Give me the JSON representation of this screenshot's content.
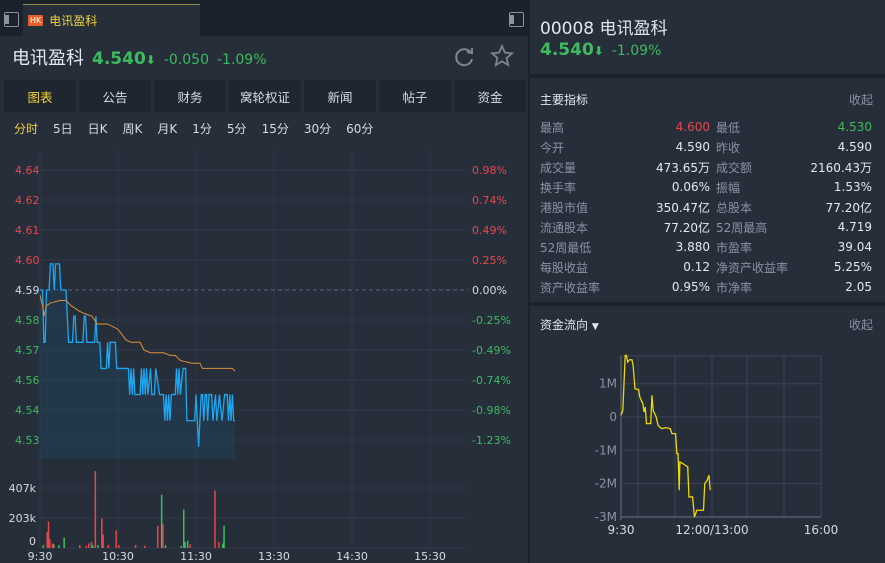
{
  "tab": {
    "market": "HK",
    "name": "电讯盈科"
  },
  "quote": {
    "name": "电讯盈科",
    "price": "4.540",
    "arrow": "⬇",
    "change": "-0.050",
    "change_pct": "-1.09%"
  },
  "menu": [
    {
      "label": "图表",
      "active": true
    },
    {
      "label": "公告"
    },
    {
      "label": "财务"
    },
    {
      "label": "窝轮权证"
    },
    {
      "label": "新闻"
    },
    {
      "label": "帖子"
    },
    {
      "label": "资金"
    }
  ],
  "periods": [
    {
      "label": "分时",
      "active": true
    },
    {
      "label": "5日"
    },
    {
      "label": "日K"
    },
    {
      "label": "周K"
    },
    {
      "label": "月K"
    },
    {
      "label": "1分"
    },
    {
      "label": "5分"
    },
    {
      "label": "15分"
    },
    {
      "label": "30分"
    },
    {
      "label": "60分"
    }
  ],
  "right": {
    "code_name": "00008 电讯盈科",
    "price": "4.540",
    "arrow": "⬇",
    "change_pct": "-1.09%"
  },
  "key_metrics": {
    "title": "主要指标",
    "collapse": "收起",
    "rows": [
      [
        {
          "label": "最高",
          "value": "4.600",
          "color": "#e8464d"
        },
        {
          "label": "最低",
          "value": "4.530",
          "color": "#3dbb5e"
        }
      ],
      [
        {
          "label": "今开",
          "value": "4.590"
        },
        {
          "label": "昨收",
          "value": "4.590"
        }
      ],
      [
        {
          "label": "成交量",
          "value": "473.65万"
        },
        {
          "label": "成交额",
          "value": "2160.43万"
        }
      ],
      [
        {
          "label": "换手率",
          "value": "0.06%"
        },
        {
          "label": "振幅",
          "value": "1.53%"
        }
      ],
      [
        {
          "label": "港股市值",
          "value": "350.47亿"
        },
        {
          "label": "总股本",
          "value": "77.20亿"
        }
      ],
      [
        {
          "label": "流通股本",
          "value": "77.20亿"
        },
        {
          "label": "52周最高",
          "value": "4.719"
        }
      ],
      [
        {
          "label": "52周最低",
          "value": "3.880"
        },
        {
          "label": "市盈率",
          "value": "39.04"
        }
      ],
      [
        {
          "label": "每股收益",
          "value": "0.12"
        },
        {
          "label": "净资产收益率",
          "value": "5.25%"
        }
      ],
      [
        {
          "label": "资产收益率",
          "value": "0.95%"
        },
        {
          "label": "市净率",
          "value": "2.05"
        }
      ]
    ]
  },
  "fund_flow": {
    "title": "资金流向",
    "collapse": "收起"
  },
  "colors": {
    "up": "#e8464d",
    "down": "#3dbb5e",
    "price_line": "#1ea7f0",
    "avg_line": "#e0903a",
    "flow_line": "#f0d800",
    "active": "#f0d23a"
  },
  "chart_data": [
    {
      "type": "line",
      "title": "分时",
      "prev_close": 4.59,
      "price_labels_left": [
        {
          "v": "4.64",
          "c": "up"
        },
        {
          "v": "4.62",
          "c": "up"
        },
        {
          "v": "4.61",
          "c": "up"
        },
        {
          "v": "4.60",
          "c": "up"
        },
        {
          "v": "4.59",
          "c": "flat"
        },
        {
          "v": "4.58",
          "c": "down"
        },
        {
          "v": "4.57",
          "c": "down"
        },
        {
          "v": "4.56",
          "c": "down"
        },
        {
          "v": "4.54",
          "c": "down"
        },
        {
          "v": "4.53",
          "c": "down"
        }
      ],
      "pct_labels_right": [
        {
          "v": "0.98%",
          "c": "up"
        },
        {
          "v": "0.74%",
          "c": "up"
        },
        {
          "v": "0.49%",
          "c": "up"
        },
        {
          "v": "0.25%",
          "c": "up"
        },
        {
          "v": "0.00%",
          "c": "flat"
        },
        {
          "v": "-0.25%",
          "c": "down"
        },
        {
          "v": "-0.49%",
          "c": "down"
        },
        {
          "v": "-0.74%",
          "c": "down"
        },
        {
          "v": "-0.98%",
          "c": "down"
        },
        {
          "v": "-1.23%",
          "c": "down"
        }
      ],
      "x_ticks": [
        "9:30",
        "10:30",
        "11:30",
        "13:30",
        "14:30",
        "15:30"
      ],
      "volume_ticks": [
        "407k",
        "203k",
        "0"
      ],
      "price": [
        [
          0,
          4.59
        ],
        [
          2,
          4.59
        ],
        [
          3,
          4.57
        ],
        [
          4,
          4.57
        ],
        [
          5,
          4.59
        ],
        [
          7,
          4.59
        ],
        [
          8,
          4.6
        ],
        [
          10,
          4.6
        ],
        [
          11,
          4.59
        ],
        [
          12,
          4.6
        ],
        [
          15,
          4.6
        ],
        [
          16,
          4.59
        ],
        [
          20,
          4.59
        ],
        [
          22,
          4.57
        ],
        [
          25,
          4.57
        ],
        [
          26,
          4.58
        ],
        [
          27,
          4.58
        ],
        [
          28,
          4.57
        ],
        [
          33,
          4.57
        ],
        [
          34,
          4.58
        ],
        [
          35,
          4.58
        ],
        [
          36,
          4.57
        ],
        [
          42,
          4.57
        ],
        [
          43,
          4.58
        ],
        [
          44,
          4.57
        ],
        [
          46,
          4.57
        ],
        [
          47,
          4.56
        ],
        [
          51,
          4.56
        ],
        [
          52,
          4.57
        ],
        [
          53,
          4.56
        ],
        [
          54,
          4.57
        ],
        [
          58,
          4.57
        ],
        [
          59,
          4.56
        ],
        [
          68,
          4.56
        ],
        [
          69,
          4.55
        ],
        [
          70,
          4.56
        ],
        [
          71,
          4.55
        ],
        [
          72,
          4.56
        ],
        [
          73,
          4.55
        ],
        [
          77,
          4.55
        ],
        [
          78,
          4.56
        ],
        [
          79,
          4.55
        ],
        [
          80,
          4.56
        ],
        [
          81,
          4.55
        ],
        [
          82,
          4.56
        ],
        [
          83,
          4.55
        ],
        [
          85,
          4.56
        ],
        [
          86,
          4.55
        ],
        [
          88,
          4.55
        ],
        [
          89,
          4.56
        ],
        [
          92,
          4.55
        ],
        [
          95,
          4.55
        ],
        [
          96,
          4.54
        ],
        [
          97,
          4.55
        ],
        [
          98,
          4.54
        ],
        [
          99,
          4.55
        ],
        [
          100,
          4.54
        ],
        [
          101,
          4.55
        ],
        [
          104,
          4.55
        ],
        [
          105,
          4.56
        ],
        [
          106,
          4.55
        ],
        [
          107,
          4.56
        ],
        [
          108,
          4.55
        ],
        [
          110,
          4.56
        ],
        [
          112,
          4.56
        ],
        [
          113,
          4.54
        ],
        [
          119,
          4.54
        ],
        [
          120,
          4.55
        ],
        [
          121,
          4.54
        ],
        [
          122,
          4.53
        ],
        [
          123,
          4.54
        ],
        [
          124,
          4.55
        ],
        [
          125,
          4.55
        ],
        [
          126,
          4.54
        ],
        [
          127,
          4.55
        ],
        [
          128,
          4.55
        ],
        [
          129,
          4.54
        ],
        [
          130,
          4.55
        ],
        [
          132,
          4.55
        ],
        [
          133,
          4.54
        ],
        [
          135,
          4.55
        ],
        [
          136,
          4.54
        ],
        [
          138,
          4.55
        ],
        [
          140,
          4.54
        ],
        [
          142,
          4.55
        ],
        [
          144,
          4.55
        ],
        [
          145,
          4.54
        ],
        [
          146,
          4.55
        ],
        [
          147,
          4.54
        ],
        [
          148,
          4.55
        ],
        [
          149,
          4.54
        ],
        [
          150,
          4.54
        ]
      ],
      "avg": [
        [
          0,
          4.588
        ],
        [
          2,
          4.584
        ],
        [
          3,
          4.58
        ],
        [
          5,
          4.584
        ],
        [
          8,
          4.585
        ],
        [
          15,
          4.586
        ],
        [
          20,
          4.586
        ],
        [
          24,
          4.584
        ],
        [
          30,
          4.582
        ],
        [
          34,
          4.581
        ],
        [
          40,
          4.58
        ],
        [
          44,
          4.577
        ],
        [
          52,
          4.577
        ],
        [
          60,
          4.575
        ],
        [
          63,
          4.573
        ],
        [
          66,
          4.571
        ],
        [
          70,
          4.57
        ],
        [
          77,
          4.57
        ],
        [
          80,
          4.567
        ],
        [
          85,
          4.566
        ],
        [
          95,
          4.566
        ],
        [
          100,
          4.565
        ],
        [
          104,
          4.565
        ],
        [
          108,
          4.563
        ],
        [
          117,
          4.562
        ],
        [
          123,
          4.562
        ],
        [
          125,
          4.56
        ],
        [
          148,
          4.56
        ],
        [
          150,
          4.559
        ]
      ],
      "volume_k": [
        [
          2,
          20,
          "d"
        ],
        [
          5,
          110,
          "u"
        ],
        [
          6,
          180,
          "u"
        ],
        [
          7,
          60,
          "u"
        ],
        [
          9,
          30,
          "u"
        ],
        [
          10,
          25,
          "d"
        ],
        [
          14,
          20,
          "d"
        ],
        [
          18,
          70,
          "d"
        ],
        [
          30,
          20,
          "u"
        ],
        [
          35,
          15,
          "u"
        ],
        [
          37,
          30,
          "u"
        ],
        [
          39,
          40,
          "u"
        ],
        [
          40,
          20,
          "d"
        ],
        [
          42,
          520,
          "u"
        ],
        [
          44,
          20,
          "d"
        ],
        [
          47,
          200,
          "u"
        ],
        [
          48,
          90,
          "u"
        ],
        [
          52,
          20,
          "u"
        ],
        [
          58,
          120,
          "u"
        ],
        [
          60,
          20,
          "u"
        ],
        [
          73,
          20,
          "u"
        ],
        [
          80,
          15,
          "u"
        ],
        [
          90,
          150,
          "u"
        ],
        [
          93,
          360,
          "d"
        ],
        [
          94,
          160,
          "u"
        ],
        [
          96,
          20,
          "d"
        ],
        [
          108,
          15,
          "d"
        ],
        [
          110,
          260,
          "d"
        ],
        [
          111,
          40,
          "d"
        ],
        [
          113,
          50,
          "d"
        ],
        [
          115,
          25,
          "u"
        ],
        [
          134,
          390,
          "u"
        ],
        [
          137,
          40,
          "u"
        ],
        [
          140,
          30,
          "d"
        ],
        [
          141,
          150,
          "d"
        ]
      ]
    },
    {
      "type": "line",
      "title": "资金流向",
      "y_ticks": [
        "1M",
        "0",
        "-1M",
        "-2M",
        "-3M"
      ],
      "x_ticks": [
        "9:30",
        "12:00/13:00",
        "16:00"
      ],
      "ylim": [
        -3,
        1.85
      ],
      "values_M": [
        [
          0,
          0.05
        ],
        [
          3,
          0.2
        ],
        [
          7,
          1.85
        ],
        [
          9,
          1.85
        ],
        [
          11,
          1.65
        ],
        [
          14,
          1.72
        ],
        [
          18,
          1.72
        ],
        [
          20,
          1.55
        ],
        [
          23,
          0.85
        ],
        [
          29,
          0.82
        ],
        [
          31,
          0.6
        ],
        [
          36,
          0.4
        ],
        [
          38,
          0.15
        ],
        [
          40,
          0.3
        ],
        [
          42,
          -0.2
        ],
        [
          49,
          -0.2
        ],
        [
          51,
          0.65
        ],
        [
          53,
          0.2
        ],
        [
          58,
          0
        ],
        [
          61,
          -0.25
        ],
        [
          67,
          -0.35
        ],
        [
          74,
          -0.32
        ],
        [
          81,
          -0.35
        ],
        [
          84,
          -0.5
        ],
        [
          90,
          -0.5
        ],
        [
          92,
          -1.1
        ],
        [
          94,
          -1.1
        ],
        [
          96,
          -2.2
        ],
        [
          97,
          -1.35
        ],
        [
          102,
          -1.4
        ],
        [
          110,
          -1.5
        ],
        [
          112,
          -2.4
        ],
        [
          118,
          -2.4
        ],
        [
          121,
          -3.0
        ],
        [
          125,
          -2.8
        ],
        [
          136,
          -2.8
        ],
        [
          138,
          -2.0
        ],
        [
          142,
          -1.9
        ],
        [
          145,
          -1.75
        ],
        [
          147,
          -2.2
        ]
      ]
    }
  ]
}
